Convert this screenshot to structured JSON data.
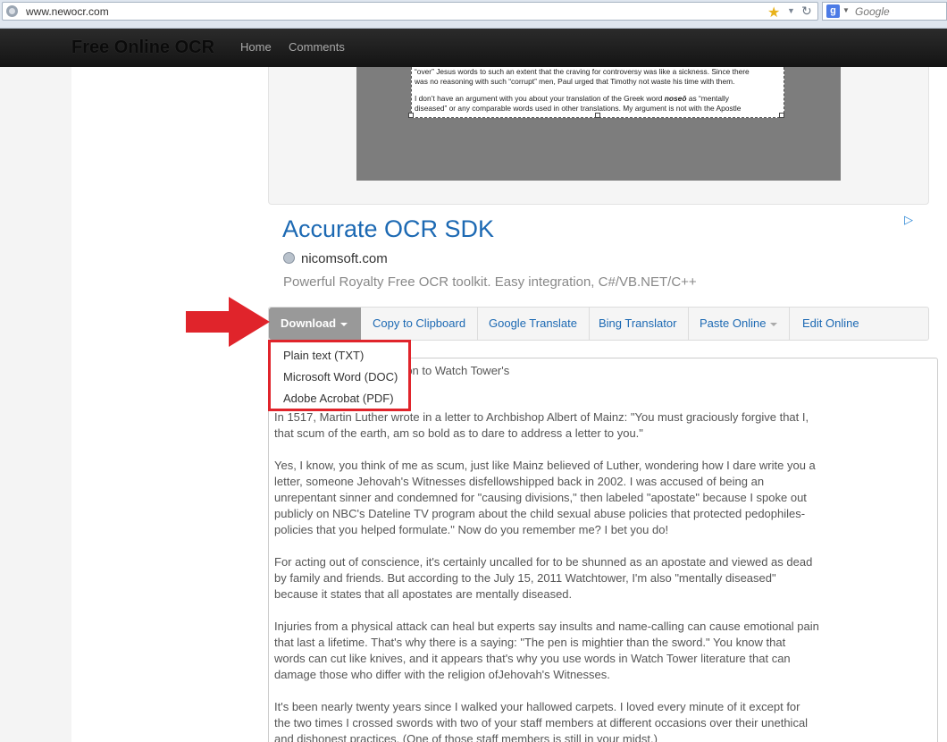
{
  "browser": {
    "url": "www.newocr.com",
    "search_placeholder": "Google",
    "search_engine_letter": "g"
  },
  "site": {
    "brand": "Free Online OCR",
    "nav": [
      "Home",
      "Comments"
    ]
  },
  "preview": {
    "line_a": "“over” Jesus words to such an extent that the craving for controversy was like a sickness. Since there",
    "line_b": "was no reasoning with such “corrupt” men, Paul urged that Timothy not waste his time with them.",
    "line_c_start": "I don’t have an argument with you about your translation of the Greek word ",
    "line_c_word": "noseō",
    "line_c_end": "  as “mentally",
    "line_d": "diseased” or any comparable words used in other translations. My argument is not with the Apostle"
  },
  "ad": {
    "title": "Accurate OCR SDK",
    "url": "nicomsoft.com",
    "description": "Powerful Royalty Free OCR toolkit. Easy integration, C#/VB.NET/C++",
    "badge_icon": "adchoices-icon"
  },
  "toolbar": {
    "download": "Download",
    "copy": "Copy to Clipboard",
    "google_translate": "Google Translate",
    "bing": "Bing Translator",
    "paste": "Paste Online",
    "edit": "Edit Online"
  },
  "download_menu": [
    "Plain text (TXT)",
    "Microsoft Word (DOC)",
    "Adobe Acrobat (PDF)"
  ],
  "colors": {
    "highlight": "#e0242b",
    "link": "#1c69b3"
  },
  "result": {
    "first_line": "o Anderson to Watch Tower's",
    "paragraphs": [
      "In 1517, Martin Luther wrote in a letter to Archbishop Albert of Mainz: \"You must graciously forgive that I, that scum of the earth, am so bold as to dare to address a letter to you.\"",
      "Yes, I know, you think of me as scum, just like Mainz believed of Luther, wondering how I dare write you a letter, someone Jehovah's Witnesses disfellowshipped back in 2002. I was accused of being an unrepentant sinner and condemned for \"causing divisions,\" then labeled \"apostate\" because I spoke out publicly on NBC's Dateline TV program about the child sexual abuse policies that protected pedophiles-policies that you helped formulate.\" Now do you remember me? I bet you do!",
      "For acting out of conscience, it's certainly uncalled for to be shunned as an apostate and viewed as dead by family and friends. But according to the July 15, 2011 Watchtower, I'm also \"mentally diseased\" because it states that all apostates are mentally diseased.",
      "Injuries from a physical attack can heal but experts say insults and name-calling can cause emotional pain that last a lifetime. That's why there is a saying: \"The pen is mightier than the sword.\" You know that words can cut like knives, and it appears that's why you use words in Watch Tower literature that can damage those who differ with the religion ofJehovah's Witnesses.",
      "It's been nearly twenty years since I walked your hallowed carpets. I loved every minute of it except for the two times I crossed swords with two of your staff members at different occasions over their unethical and dishonest practices. (One of those staff members is still in your midst.)"
    ]
  }
}
